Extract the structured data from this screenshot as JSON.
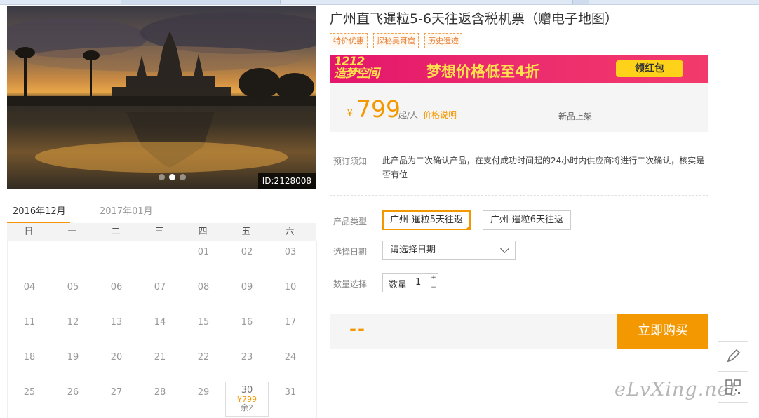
{
  "hero": {
    "id_badge": "ID:2128008",
    "dots": 3,
    "active_dot": 1
  },
  "product": {
    "title": "广州直飞暹粒5-6天往返含税机票（赠电子地图）",
    "tags": [
      "特价优惠",
      "探秘吴哥窟",
      "历史遗迹"
    ],
    "banner": {
      "logo_line1": "1212",
      "logo_line2": "造梦空间",
      "slogan": "梦想价格低至4折",
      "button": "领红包",
      "bg_color": "#e4156b",
      "accent_color": "#ffe14d"
    },
    "price": {
      "currency": "¥",
      "value": "799",
      "unit": "起/人",
      "explain_link": "价格说明",
      "status": "新品上架"
    },
    "notice": {
      "label": "预订须知",
      "text": "此产品为二次确认产品，在支付成功时间起的24小时内供应商将进行二次确认，核实是否有位"
    },
    "type_label": "产品类型",
    "types": [
      "广州-暹粒5天往返",
      "广州-暹粒6天往返"
    ],
    "selected_type_index": 0,
    "date_label": "选择日期",
    "date_placeholder": "请选择日期",
    "qty_label": "数量选择",
    "qty_prefix": "数量",
    "qty_value": "1",
    "qty_plus": "+",
    "qty_minus": "−",
    "total": "--",
    "buy_button": "立即购买",
    "accent_color": "#f39800"
  },
  "calendar": {
    "months": [
      "2016年12月",
      "2017年01月"
    ],
    "active_month_index": 0,
    "weekdays": [
      "日",
      "一",
      "二",
      "三",
      "四",
      "五",
      "六"
    ],
    "days": [
      "01",
      "02",
      "03",
      "04",
      "05",
      "06",
      "07",
      "08",
      "09",
      "10",
      "11",
      "12",
      "13",
      "14",
      "15",
      "16",
      "17",
      "18",
      "19",
      "20",
      "21",
      "22",
      "23",
      "24",
      "25",
      "26",
      "27",
      "28",
      "29",
      "30",
      "31"
    ],
    "first_weekday_index": 4,
    "available": [
      {
        "day": "30",
        "price": "¥799",
        "stock": "余2"
      }
    ]
  },
  "side_tools": [
    "edit-icon",
    "qr-code-icon"
  ],
  "watermark": "eLvXing.net"
}
